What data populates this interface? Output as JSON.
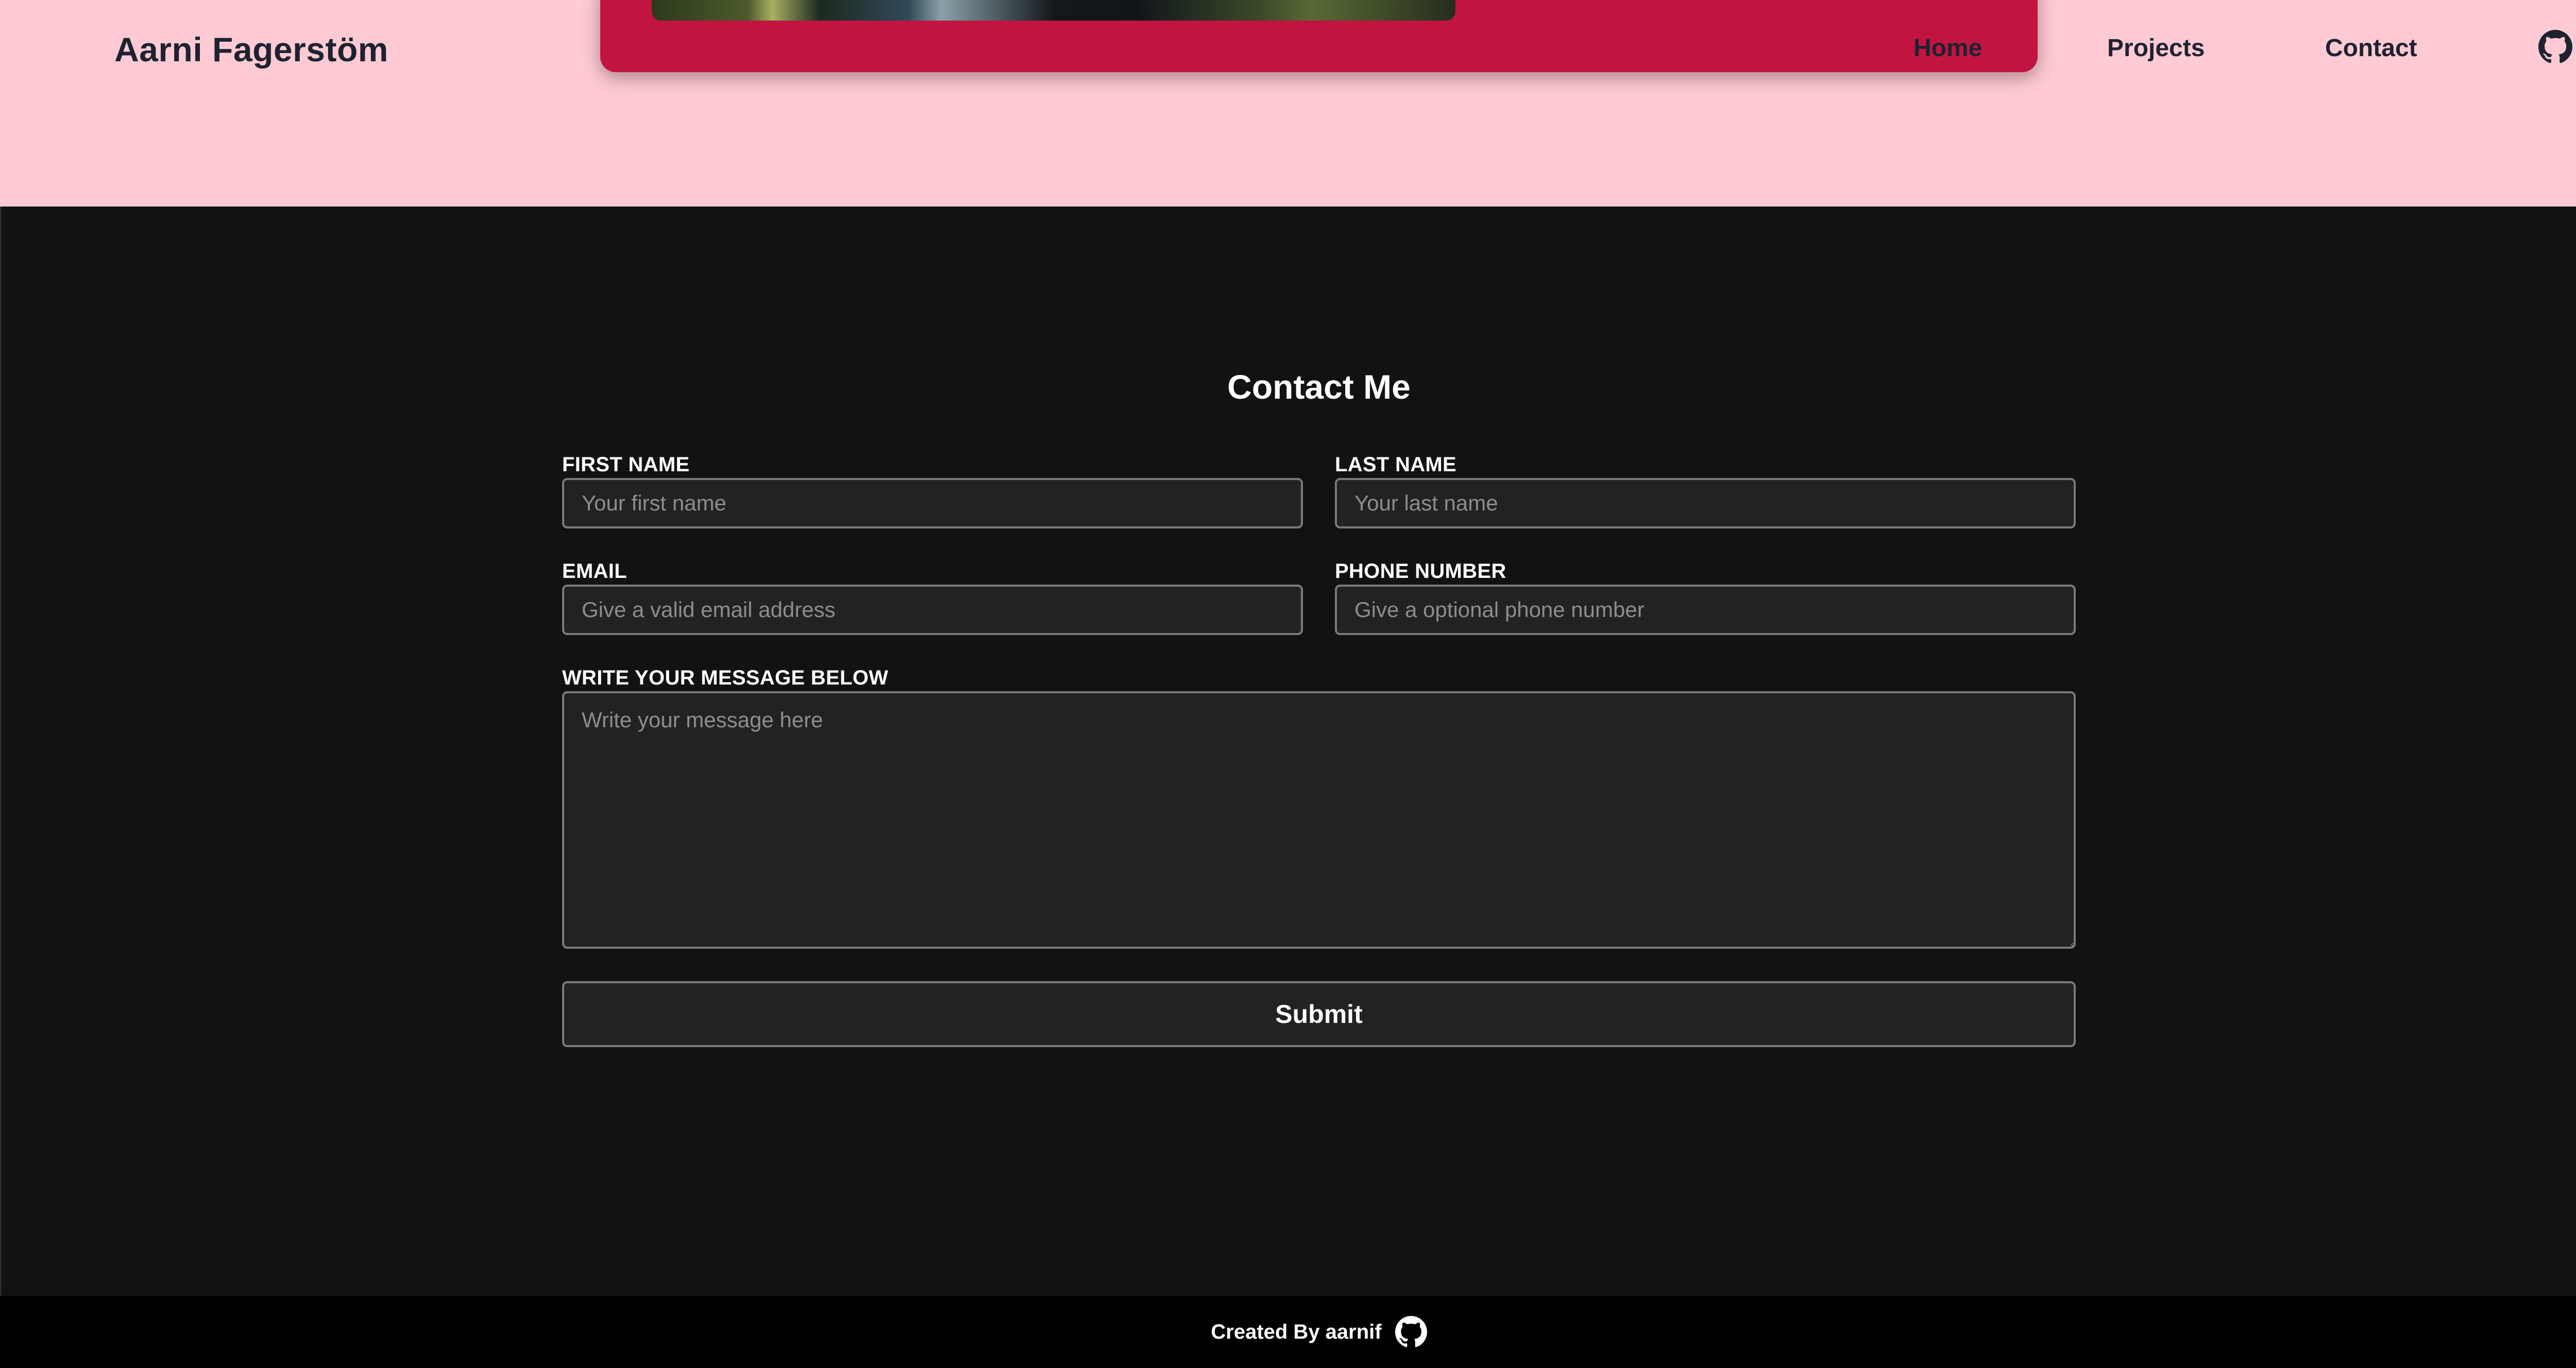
{
  "header": {
    "brand": "Aarni Fagerstöm",
    "nav": [
      {
        "label": "Home"
      },
      {
        "label": "Projects"
      },
      {
        "label": "Contact"
      }
    ],
    "github_icon": "github-icon"
  },
  "contact": {
    "title": "Contact Me",
    "first_name": {
      "label": "FIRST NAME",
      "placeholder": "Your first name",
      "value": ""
    },
    "last_name": {
      "label": "LAST NAME",
      "placeholder": "Your last name",
      "value": ""
    },
    "email": {
      "label": "EMAIL",
      "placeholder": "Give a valid email address",
      "value": ""
    },
    "phone": {
      "label": "PHONE NUMBER",
      "placeholder": "Give a optional phone number",
      "value": ""
    },
    "message": {
      "label": "WRITE YOUR MESSAGE BELOW",
      "placeholder": "Write your message here",
      "value": ""
    },
    "submit_label": "Submit"
  },
  "footer": {
    "text": "Created By aarnif",
    "github_icon": "github-icon"
  },
  "colors": {
    "header_bg": "#ffcad3",
    "hero_card": "#c21441",
    "page_bg": "#121212",
    "field_bg": "#222222",
    "footer_bg": "#000000",
    "text_dark": "#1e2230"
  }
}
